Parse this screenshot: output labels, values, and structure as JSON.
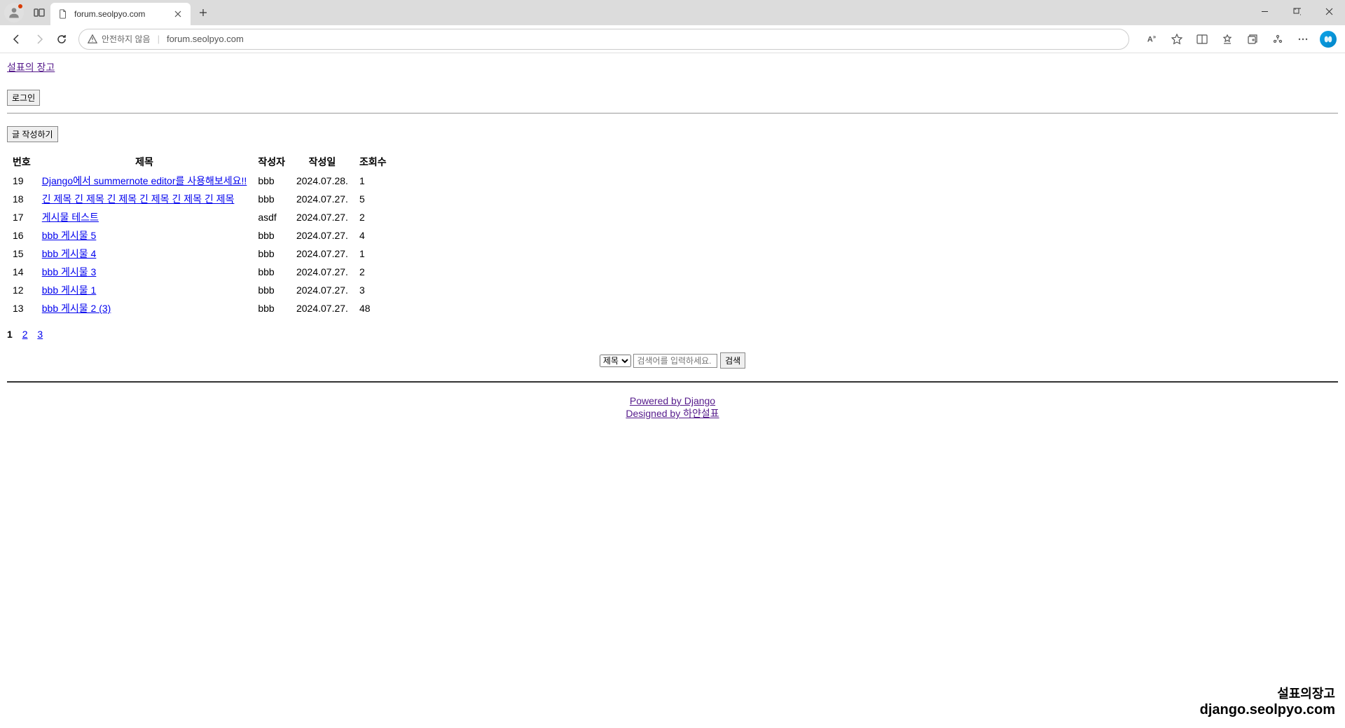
{
  "browser": {
    "tab_title": "forum.seolpyo.com",
    "security_text": "안전하지 않음",
    "url": "forum.seolpyo.com"
  },
  "page": {
    "site_title": "설표의 장고",
    "login_button": "로그인",
    "write_button": "글 작성하기"
  },
  "table": {
    "headers": {
      "no": "번호",
      "title": "제목",
      "author": "작성자",
      "date": "작성일",
      "views": "조회수"
    },
    "rows": [
      {
        "no": "19",
        "title": "Django에서 summernote editor를 사용해보세요!!",
        "author": "bbb",
        "date": "2024.07.28.",
        "views": "1"
      },
      {
        "no": "18",
        "title": "긴 제목 긴 제목 긴 제목 긴 제목 긴 제목 긴 제목",
        "author": "bbb",
        "date": "2024.07.27.",
        "views": "5"
      },
      {
        "no": "17",
        "title": "게시물 테스트",
        "author": "asdf",
        "date": "2024.07.27.",
        "views": "2"
      },
      {
        "no": "16",
        "title": "bbb 게시물 5",
        "author": "bbb",
        "date": "2024.07.27.",
        "views": "4"
      },
      {
        "no": "15",
        "title": "bbb 게시물 4",
        "author": "bbb",
        "date": "2024.07.27.",
        "views": "1"
      },
      {
        "no": "14",
        "title": "bbb 게시물 3",
        "author": "bbb",
        "date": "2024.07.27.",
        "views": "2"
      },
      {
        "no": "12",
        "title": "bbb 게시물 1",
        "author": "bbb",
        "date": "2024.07.27.",
        "views": "3"
      },
      {
        "no": "13",
        "title": "bbb 게시물 2 (3)",
        "author": "bbb",
        "date": "2024.07.27.",
        "views": "48"
      }
    ]
  },
  "pagination": {
    "current": "1",
    "p2": "2",
    "p3": "3"
  },
  "search": {
    "option_title": "제목",
    "placeholder": "검색어를 입력하세요.",
    "button": "검색"
  },
  "footer": {
    "powered": "Powered by Django",
    "designed": "Designed by 하얀설표"
  },
  "watermark": {
    "title": "설표의장고",
    "url": "django.seolpyo.com"
  }
}
